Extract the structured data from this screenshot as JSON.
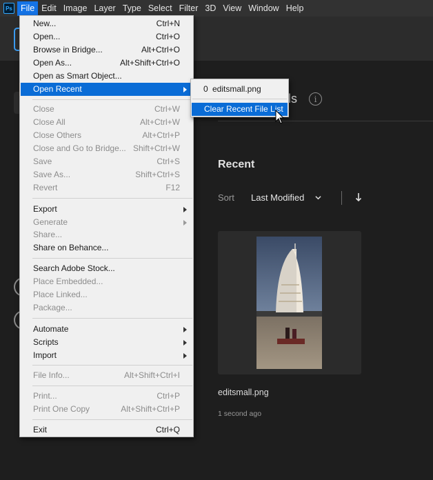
{
  "app": {
    "logo_text": "Ps"
  },
  "menubar": {
    "items": [
      "File",
      "Edit",
      "Image",
      "Layer",
      "Type",
      "Select",
      "Filter",
      "3D",
      "View",
      "Window",
      "Help"
    ]
  },
  "home": {
    "heading_tail": "lls",
    "info_glyph": "i",
    "recent_title": "Recent",
    "sort_label": "Sort",
    "sort_value": "Last Modified",
    "recent_files": [
      {
        "name": "editsmall.png",
        "time": "1 second ago"
      }
    ]
  },
  "file_menu": {
    "items": [
      {
        "label": "New...",
        "shortcut": "Ctrl+N"
      },
      {
        "label": "Open...",
        "shortcut": "Ctrl+O"
      },
      {
        "label": "Browse in Bridge...",
        "shortcut": "Alt+Ctrl+O"
      },
      {
        "label": "Open As...",
        "shortcut": "Alt+Shift+Ctrl+O"
      },
      {
        "label": "Open as Smart Object...",
        "shortcut": ""
      },
      {
        "label": "Open Recent",
        "shortcut": ""
      },
      {
        "label": "Close",
        "shortcut": "Ctrl+W"
      },
      {
        "label": "Close All",
        "shortcut": "Alt+Ctrl+W"
      },
      {
        "label": "Close Others",
        "shortcut": "Alt+Ctrl+P"
      },
      {
        "label": "Close and Go to Bridge...",
        "shortcut": "Shift+Ctrl+W"
      },
      {
        "label": "Save",
        "shortcut": "Ctrl+S"
      },
      {
        "label": "Save As...",
        "shortcut": "Shift+Ctrl+S"
      },
      {
        "label": "Revert",
        "shortcut": "F12"
      },
      {
        "label": "Export",
        "shortcut": ""
      },
      {
        "label": "Generate",
        "shortcut": ""
      },
      {
        "label": "Share...",
        "shortcut": ""
      },
      {
        "label": "Share on Behance...",
        "shortcut": ""
      },
      {
        "label": "Search Adobe Stock...",
        "shortcut": ""
      },
      {
        "label": "Place Embedded...",
        "shortcut": ""
      },
      {
        "label": "Place Linked...",
        "shortcut": ""
      },
      {
        "label": "Package...",
        "shortcut": ""
      },
      {
        "label": "Automate",
        "shortcut": ""
      },
      {
        "label": "Scripts",
        "shortcut": ""
      },
      {
        "label": "Import",
        "shortcut": ""
      },
      {
        "label": "File Info...",
        "shortcut": "Alt+Shift+Ctrl+I"
      },
      {
        "label": "Print...",
        "shortcut": "Ctrl+P"
      },
      {
        "label": "Print One Copy",
        "shortcut": "Alt+Shift+Ctrl+P"
      },
      {
        "label": "Exit",
        "shortcut": "Ctrl+Q"
      }
    ]
  },
  "open_recent_submenu": {
    "recent_index": "0",
    "recent_file": "editsmall.png",
    "clear_label": "Clear Recent File List"
  },
  "colors": {
    "highlight": "#0a6cd6",
    "menubar_active": "#1473e6",
    "background": "#1e1e1e"
  }
}
